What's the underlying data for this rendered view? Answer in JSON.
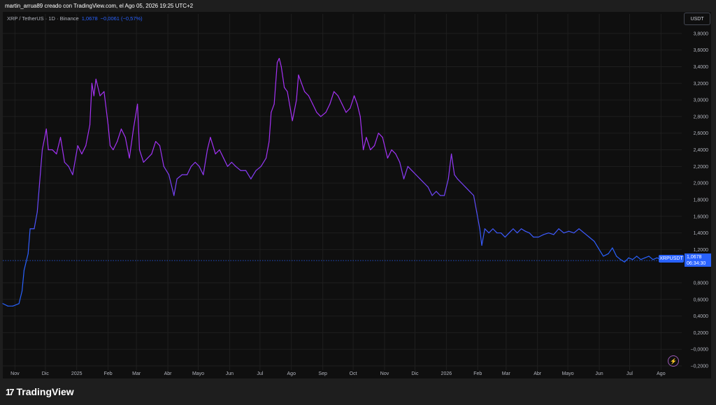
{
  "header": {
    "caption": "martin_arrua89 creado con TradingView.com, el Ago 05, 2026 19:25 UTC+2"
  },
  "legend": {
    "symbol": "XRP / TetherUS · 1D · Binance",
    "last": "1,0678",
    "change": "−0,0061 (−0,57%)"
  },
  "currency_button": "USDT",
  "price_tag": {
    "name": "XRPUSDT",
    "price": "1,0678",
    "countdown": "06:34:30"
  },
  "footer": {
    "brand": "TradingView"
  },
  "colors": {
    "background": "#0f0f0f",
    "line_start": "#2962ff",
    "line_peak": "#a532f5",
    "grid": "#1f1f1f"
  },
  "chart_data": {
    "type": "line",
    "series": [
      {
        "name": "XRPUSDT",
        "points": [
          [
            "2024-10-20",
            0.55
          ],
          [
            "2024-10-25",
            0.52
          ],
          [
            "2024-10-30",
            0.52
          ],
          [
            "2024-11-05",
            0.55
          ],
          [
            "2024-11-08",
            0.7
          ],
          [
            "2024-11-10",
            0.95
          ],
          [
            "2024-11-12",
            1.05
          ],
          [
            "2024-11-14",
            1.15
          ],
          [
            "2024-11-16",
            1.45
          ],
          [
            "2024-11-20",
            1.45
          ],
          [
            "2024-11-23",
            1.65
          ],
          [
            "2024-11-25",
            1.95
          ],
          [
            "2024-11-28",
            2.4
          ],
          [
            "2024-12-02",
            2.65
          ],
          [
            "2024-12-04",
            2.4
          ],
          [
            "2024-12-08",
            2.4
          ],
          [
            "2024-12-12",
            2.35
          ],
          [
            "2024-12-16",
            2.55
          ],
          [
            "2024-12-20",
            2.25
          ],
          [
            "2024-12-24",
            2.2
          ],
          [
            "2024-12-28",
            2.1
          ],
          [
            "2025-01-02",
            2.45
          ],
          [
            "2025-01-06",
            2.35
          ],
          [
            "2025-01-10",
            2.45
          ],
          [
            "2025-01-14",
            2.7
          ],
          [
            "2025-01-16",
            3.2
          ],
          [
            "2025-01-18",
            3.05
          ],
          [
            "2025-01-20",
            3.25
          ],
          [
            "2025-01-24",
            3.05
          ],
          [
            "2025-01-28",
            3.1
          ],
          [
            "2025-02-01",
            2.7
          ],
          [
            "2025-02-03",
            2.45
          ],
          [
            "2025-02-06",
            2.4
          ],
          [
            "2025-02-10",
            2.5
          ],
          [
            "2025-02-14",
            2.65
          ],
          [
            "2025-02-18",
            2.55
          ],
          [
            "2025-02-22",
            2.3
          ],
          [
            "2025-02-26",
            2.65
          ],
          [
            "2025-03-02",
            2.95
          ],
          [
            "2025-03-04",
            2.4
          ],
          [
            "2025-03-08",
            2.25
          ],
          [
            "2025-03-12",
            2.3
          ],
          [
            "2025-03-16",
            2.35
          ],
          [
            "2025-03-20",
            2.5
          ],
          [
            "2025-03-24",
            2.45
          ],
          [
            "2025-03-28",
            2.2
          ],
          [
            "2025-04-02",
            2.1
          ],
          [
            "2025-04-07",
            1.85
          ],
          [
            "2025-04-10",
            2.05
          ],
          [
            "2025-04-15",
            2.1
          ],
          [
            "2025-04-20",
            2.1
          ],
          [
            "2025-04-24",
            2.2
          ],
          [
            "2025-04-28",
            2.25
          ],
          [
            "2025-05-02",
            2.2
          ],
          [
            "2025-05-06",
            2.1
          ],
          [
            "2025-05-10",
            2.4
          ],
          [
            "2025-05-13",
            2.55
          ],
          [
            "2025-05-18",
            2.35
          ],
          [
            "2025-05-22",
            2.4
          ],
          [
            "2025-05-26",
            2.3
          ],
          [
            "2025-05-30",
            2.2
          ],
          [
            "2025-06-03",
            2.25
          ],
          [
            "2025-06-07",
            2.2
          ],
          [
            "2025-06-12",
            2.15
          ],
          [
            "2025-06-17",
            2.15
          ],
          [
            "2025-06-22",
            2.05
          ],
          [
            "2025-06-27",
            2.15
          ],
          [
            "2025-07-02",
            2.2
          ],
          [
            "2025-07-07",
            2.3
          ],
          [
            "2025-07-10",
            2.5
          ],
          [
            "2025-07-12",
            2.85
          ],
          [
            "2025-07-15",
            2.95
          ],
          [
            "2025-07-18",
            3.45
          ],
          [
            "2025-07-20",
            3.5
          ],
          [
            "2025-07-22",
            3.4
          ],
          [
            "2025-07-25",
            3.15
          ],
          [
            "2025-07-28",
            3.1
          ],
          [
            "2025-08-02",
            2.75
          ],
          [
            "2025-08-06",
            3.0
          ],
          [
            "2025-08-08",
            3.3
          ],
          [
            "2025-08-11",
            3.2
          ],
          [
            "2025-08-14",
            3.1
          ],
          [
            "2025-08-18",
            3.05
          ],
          [
            "2025-08-22",
            2.95
          ],
          [
            "2025-08-26",
            2.85
          ],
          [
            "2025-08-30",
            2.8
          ],
          [
            "2025-09-04",
            2.85
          ],
          [
            "2025-09-08",
            2.95
          ],
          [
            "2025-09-12",
            3.1
          ],
          [
            "2025-09-16",
            3.05
          ],
          [
            "2025-09-20",
            2.95
          ],
          [
            "2025-09-24",
            2.85
          ],
          [
            "2025-09-28",
            2.9
          ],
          [
            "2025-10-02",
            3.05
          ],
          [
            "2025-10-05",
            2.95
          ],
          [
            "2025-10-08",
            2.8
          ],
          [
            "2025-10-11",
            2.4
          ],
          [
            "2025-10-14",
            2.55
          ],
          [
            "2025-10-18",
            2.4
          ],
          [
            "2025-10-22",
            2.45
          ],
          [
            "2025-10-26",
            2.6
          ],
          [
            "2025-10-30",
            2.55
          ],
          [
            "2025-11-04",
            2.3
          ],
          [
            "2025-11-08",
            2.4
          ],
          [
            "2025-11-12",
            2.35
          ],
          [
            "2025-11-16",
            2.25
          ],
          [
            "2025-11-20",
            2.05
          ],
          [
            "2025-11-24",
            2.2
          ],
          [
            "2025-11-28",
            2.15
          ],
          [
            "2025-12-02",
            2.1
          ],
          [
            "2025-12-06",
            2.05
          ],
          [
            "2025-12-10",
            2.0
          ],
          [
            "2025-12-14",
            1.95
          ],
          [
            "2025-12-18",
            1.85
          ],
          [
            "2025-12-22",
            1.9
          ],
          [
            "2025-12-26",
            1.85
          ],
          [
            "2025-12-30",
            1.85
          ],
          [
            "2026-01-03",
            2.05
          ],
          [
            "2026-01-06",
            2.35
          ],
          [
            "2026-01-09",
            2.1
          ],
          [
            "2026-01-12",
            2.05
          ],
          [
            "2026-01-16",
            2.0
          ],
          [
            "2026-01-20",
            1.95
          ],
          [
            "2026-01-24",
            1.9
          ],
          [
            "2026-01-28",
            1.85
          ],
          [
            "2026-01-31",
            1.65
          ],
          [
            "2026-02-03",
            1.45
          ],
          [
            "2026-02-05",
            1.25
          ],
          [
            "2026-02-08",
            1.45
          ],
          [
            "2026-02-12",
            1.4
          ],
          [
            "2026-02-16",
            1.45
          ],
          [
            "2026-02-20",
            1.4
          ],
          [
            "2026-02-24",
            1.4
          ],
          [
            "2026-02-28",
            1.35
          ],
          [
            "2026-03-04",
            1.4
          ],
          [
            "2026-03-08",
            1.45
          ],
          [
            "2026-03-12",
            1.4
          ],
          [
            "2026-03-16",
            1.45
          ],
          [
            "2026-03-20",
            1.42
          ],
          [
            "2026-03-24",
            1.4
          ],
          [
            "2026-03-28",
            1.35
          ],
          [
            "2026-04-02",
            1.35
          ],
          [
            "2026-04-07",
            1.38
          ],
          [
            "2026-04-12",
            1.4
          ],
          [
            "2026-04-17",
            1.38
          ],
          [
            "2026-04-22",
            1.45
          ],
          [
            "2026-04-27",
            1.4
          ],
          [
            "2026-05-02",
            1.42
          ],
          [
            "2026-05-07",
            1.4
          ],
          [
            "2026-05-12",
            1.45
          ],
          [
            "2026-05-17",
            1.4
          ],
          [
            "2026-05-22",
            1.35
          ],
          [
            "2026-05-27",
            1.3
          ],
          [
            "2026-06-01",
            1.2
          ],
          [
            "2026-06-05",
            1.12
          ],
          [
            "2026-06-10",
            1.15
          ],
          [
            "2026-06-14",
            1.22
          ],
          [
            "2026-06-18",
            1.12
          ],
          [
            "2026-06-22",
            1.08
          ],
          [
            "2026-06-26",
            1.05
          ],
          [
            "2026-06-30",
            1.1
          ],
          [
            "2026-07-04",
            1.08
          ],
          [
            "2026-07-08",
            1.12
          ],
          [
            "2026-07-12",
            1.08
          ],
          [
            "2026-07-16",
            1.1
          ],
          [
            "2026-07-20",
            1.12
          ],
          [
            "2026-07-24",
            1.08
          ],
          [
            "2026-07-28",
            1.1
          ],
          [
            "2026-08-01",
            1.08
          ],
          [
            "2026-08-05",
            1.0678
          ]
        ]
      }
    ],
    "last_value": 1.0678,
    "y_ticks": [
      {
        "value": 3.8,
        "label": "3,8000"
      },
      {
        "value": 3.6,
        "label": "3,6000"
      },
      {
        "value": 3.4,
        "label": "3,4000"
      },
      {
        "value": 3.2,
        "label": "3,2000"
      },
      {
        "value": 3.0,
        "label": "3,0000"
      },
      {
        "value": 2.8,
        "label": "2,8000"
      },
      {
        "value": 2.6,
        "label": "2,6000"
      },
      {
        "value": 2.4,
        "label": "2,4000"
      },
      {
        "value": 2.2,
        "label": "2,2000"
      },
      {
        "value": 2.0,
        "label": "2,0000"
      },
      {
        "value": 1.8,
        "label": "1,8000"
      },
      {
        "value": 1.6,
        "label": "1,6000"
      },
      {
        "value": 1.4,
        "label": "1,4000"
      },
      {
        "value": 1.2,
        "label": "1,2000"
      },
      {
        "value": 0.8,
        "label": "0,8000"
      },
      {
        "value": 0.6,
        "label": "0,6000"
      },
      {
        "value": 0.4,
        "label": "0,4000"
      },
      {
        "value": 0.2,
        "label": "0,2000"
      },
      {
        "value": 0.0,
        "label": "−0,0000"
      },
      {
        "value": -0.2,
        "label": "−0,2000"
      }
    ],
    "x_ticks": [
      {
        "date": "2024-11-01",
        "label": "Nov"
      },
      {
        "date": "2024-12-01",
        "label": "Dic"
      },
      {
        "date": "2025-01-01",
        "label": "2025"
      },
      {
        "date": "2025-02-01",
        "label": "Feb"
      },
      {
        "date": "2025-03-01",
        "label": "Mar"
      },
      {
        "date": "2025-04-01",
        "label": "Abr"
      },
      {
        "date": "2025-05-01",
        "label": "Mayo"
      },
      {
        "date": "2025-06-01",
        "label": "Jun"
      },
      {
        "date": "2025-07-01",
        "label": "Jul"
      },
      {
        "date": "2025-08-01",
        "label": "Ago"
      },
      {
        "date": "2025-09-01",
        "label": "Sep"
      },
      {
        "date": "2025-10-01",
        "label": "Oct"
      },
      {
        "date": "2025-11-01",
        "label": "Nov"
      },
      {
        "date": "2025-12-01",
        "label": "Dic"
      },
      {
        "date": "2026-01-01",
        "label": "2026"
      },
      {
        "date": "2026-02-01",
        "label": "Feb"
      },
      {
        "date": "2026-03-01",
        "label": "Mar"
      },
      {
        "date": "2026-04-01",
        "label": "Abr"
      },
      {
        "date": "2026-05-01",
        "label": "Mayo"
      },
      {
        "date": "2026-06-01",
        "label": "Jun"
      },
      {
        "date": "2026-07-01",
        "label": "Jul"
      },
      {
        "date": "2026-08-01",
        "label": "Ago"
      }
    ],
    "x_range": [
      "2024-10-20",
      "2026-08-18"
    ],
    "ylim": [
      -0.25,
      3.95
    ],
    "grid": true
  }
}
